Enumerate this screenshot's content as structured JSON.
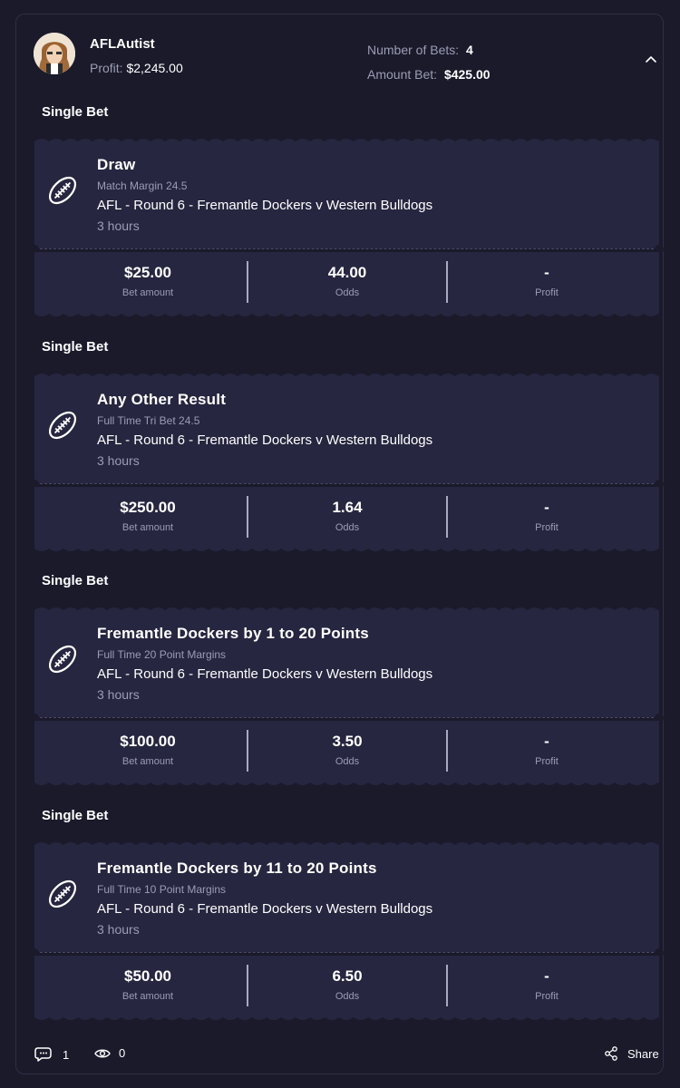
{
  "user": {
    "name": "AFLAutist",
    "profit_label": "Profit:",
    "profit_value": "$2,245.00",
    "bets_label": "Number of Bets:",
    "bets_value": "4",
    "amount_label": "Amount Bet:",
    "amount_value": "$425.00"
  },
  "bets": [
    {
      "type": "Single Bet",
      "selection": "Draw",
      "market": "Match Margin 24.5",
      "event": "AFL - Round 6 - Fremantle Dockers v Western Bulldogs",
      "time": "3 hours",
      "amount": "$25.00",
      "amount_label": "Bet amount",
      "odds": "44.00",
      "odds_label": "Odds",
      "profit": "-",
      "profit_label": "Profit"
    },
    {
      "type": "Single Bet",
      "selection": "Any Other Result",
      "market": "Full Time Tri Bet 24.5",
      "event": "AFL - Round 6 - Fremantle Dockers v Western Bulldogs",
      "time": "3 hours",
      "amount": "$250.00",
      "amount_label": "Bet amount",
      "odds": "1.64",
      "odds_label": "Odds",
      "profit": "-",
      "profit_label": "Profit"
    },
    {
      "type": "Single Bet",
      "selection": "Fremantle Dockers by 1 to 20 Points",
      "market": "Full Time 20 Point Margins",
      "event": "AFL - Round 6 - Fremantle Dockers v Western Bulldogs",
      "time": "3 hours",
      "amount": "$100.00",
      "amount_label": "Bet amount",
      "odds": "3.50",
      "odds_label": "Odds",
      "profit": "-",
      "profit_label": "Profit"
    },
    {
      "type": "Single Bet",
      "selection": "Fremantle Dockers by 11 to 20 Points",
      "market": "Full Time 10 Point Margins",
      "event": "AFL - Round 6 - Fremantle Dockers v Western Bulldogs",
      "time": "3 hours",
      "amount": "$50.00",
      "amount_label": "Bet amount",
      "odds": "6.50",
      "odds_label": "Odds",
      "profit": "-",
      "profit_label": "Profit"
    }
  ],
  "footer": {
    "comments_count": "1",
    "views_count": "0",
    "share_label": "Share"
  },
  "icons": {
    "collapse": "chevron-up-icon",
    "sport": "football-icon",
    "comments": "chat-icon",
    "views": "eye-icon",
    "share": "share-icon"
  },
  "colors": {
    "background": "#1a1a2b",
    "ticket": "#262640",
    "muted_text": "#9c9cb4"
  }
}
